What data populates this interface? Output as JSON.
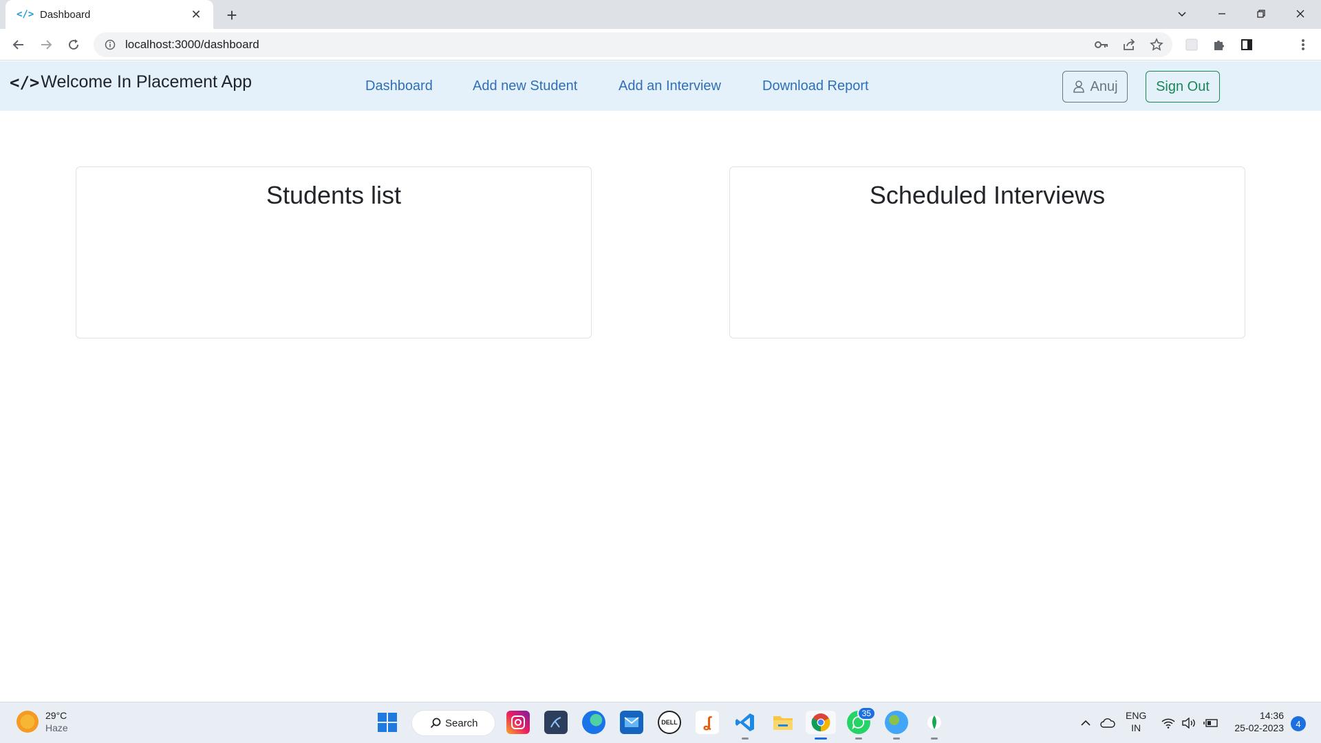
{
  "browser": {
    "tab_title": "Dashboard",
    "url": "localhost:3000/dashboard"
  },
  "app": {
    "brand": "Welcome In Placement App",
    "nav_links": [
      "Dashboard",
      "Add new Student",
      "Add an Interview",
      "Download Report"
    ],
    "user_button": "Anuj",
    "signout_button": "Sign Out"
  },
  "cards": {
    "students_title": "Students list",
    "interviews_title": "Scheduled Interviews"
  },
  "taskbar": {
    "temperature": "29°C",
    "weather": "Haze",
    "search_label": "Search",
    "whatsapp_badge": "35",
    "language_top": "ENG",
    "language_bottom": "IN",
    "time": "14:36",
    "date": "25-02-2023",
    "notification_count": "4"
  },
  "colors": {
    "navbar_bg": "#e4f1fb",
    "link": "#2f6fb6",
    "success": "#198754",
    "secondary": "#6c757d"
  }
}
